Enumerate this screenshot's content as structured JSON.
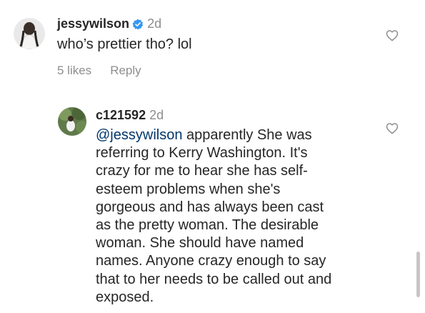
{
  "comments": [
    {
      "username": "jessywilson",
      "verified": true,
      "time": "2d",
      "text": "who’s prettier tho? lol",
      "likes": "5 likes",
      "reply": "Reply",
      "like_icon": "heart-outline-icon"
    },
    {
      "username": "c121592",
      "verified": false,
      "time": "2d",
      "mention": "@jessywilson",
      "lines": [
        " apparently She was",
        "referring to Kerry Washington. It's",
        "crazy for me to hear she has self-",
        "esteem problems when she's",
        "gorgeous and has always been cast",
        "as the pretty woman. The desirable",
        "woman. She should have named",
        "names. Anyone crazy enough to say",
        "that to her needs to be called out and",
        "exposed."
      ],
      "like_icon": "heart-outline-icon"
    }
  ],
  "colors": {
    "text": "#262626",
    "secondary": "#8e8e8e",
    "mention": "#00376b",
    "verified": "#3897f0"
  }
}
